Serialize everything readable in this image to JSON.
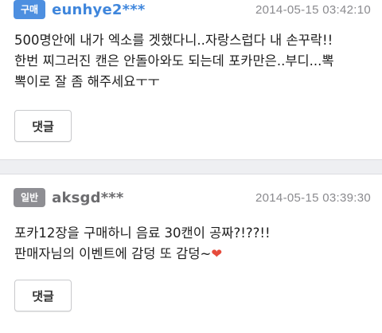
{
  "reviews": [
    {
      "badge": "구매",
      "badge_color": "#4d8fe0",
      "username": "eunhye2***",
      "timestamp": "2014-05-15 03:42:10",
      "text": "500명안에 내가 엑소를 겟했다니..자랑스럽다 내 손꾸락!!\n한번 찌그러진 캔은 안돌아와도 되는데 포카만은..부디...뽁\n뽁이로 잘 좀 해주세요ㅜㅜ",
      "reply_label": "댓글"
    },
    {
      "badge": "일반",
      "badge_color": "#8e8e93",
      "username": "aksgd***",
      "timestamp": "2014-05-15 03:39:30",
      "text": "포카12장을 구매하니 음료 30캔이 공짜?!??!!\n판매자님의 이벤트에 감덩 또 감덩~",
      "heart": "❤",
      "reply_label": "댓글"
    }
  ],
  "colors": {
    "separator": "#eeeff2",
    "username_buy": "#3f86dc",
    "username_general": "#6c6c6f",
    "heart": "#e64b3c"
  }
}
